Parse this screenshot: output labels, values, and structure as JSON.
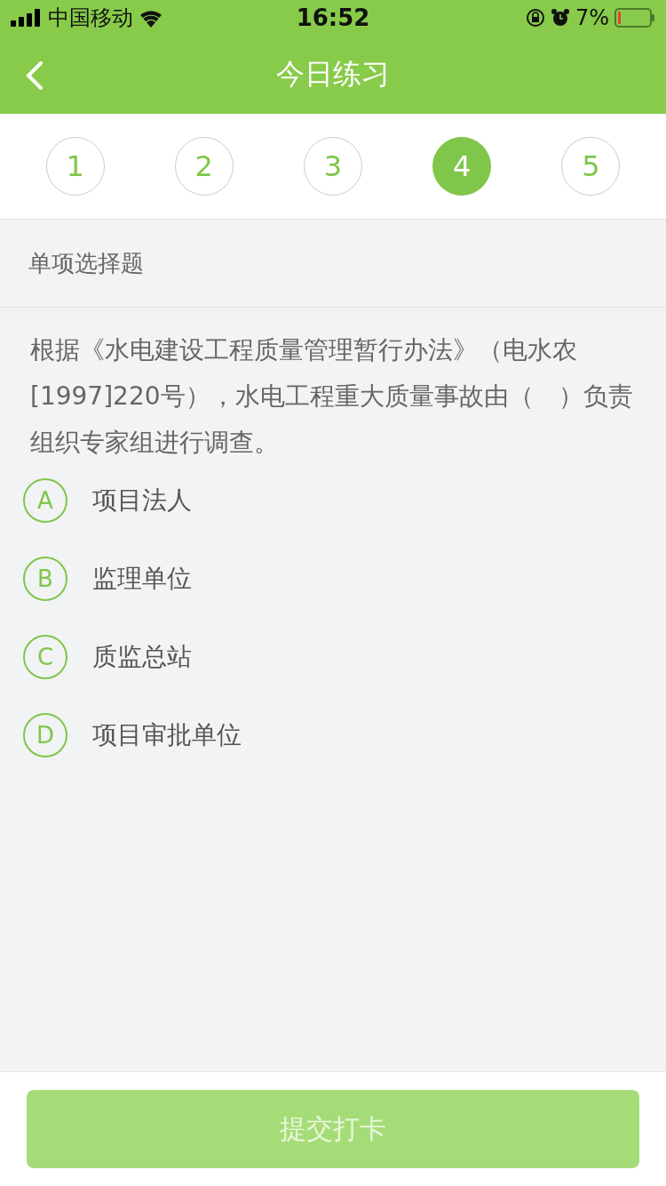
{
  "status_bar": {
    "carrier": "中国移动",
    "time": "16:52",
    "battery_percent": "7%"
  },
  "nav": {
    "title": "今日练习"
  },
  "steps": [
    {
      "label": "1",
      "selected": false
    },
    {
      "label": "2",
      "selected": false
    },
    {
      "label": "3",
      "selected": false
    },
    {
      "label": "4",
      "selected": true
    },
    {
      "label": "5",
      "selected": false
    }
  ],
  "section": {
    "title": "单项选择题"
  },
  "question": {
    "text": "根据《水电建设工程质量管理暂行办法》（电水农[1997]220号），水电工程重大质量事故由（　）负责组织专家组进行调查。"
  },
  "options": [
    {
      "letter": "A",
      "text": "项目法人",
      "selected": false
    },
    {
      "letter": "B",
      "text": "监理单位",
      "selected": false
    },
    {
      "letter": "C",
      "text": "质监总站",
      "selected": false
    },
    {
      "letter": "D",
      "text": "项目审批单位",
      "selected": false
    }
  ],
  "submit": {
    "label": "提交打卡",
    "disabled": true
  }
}
